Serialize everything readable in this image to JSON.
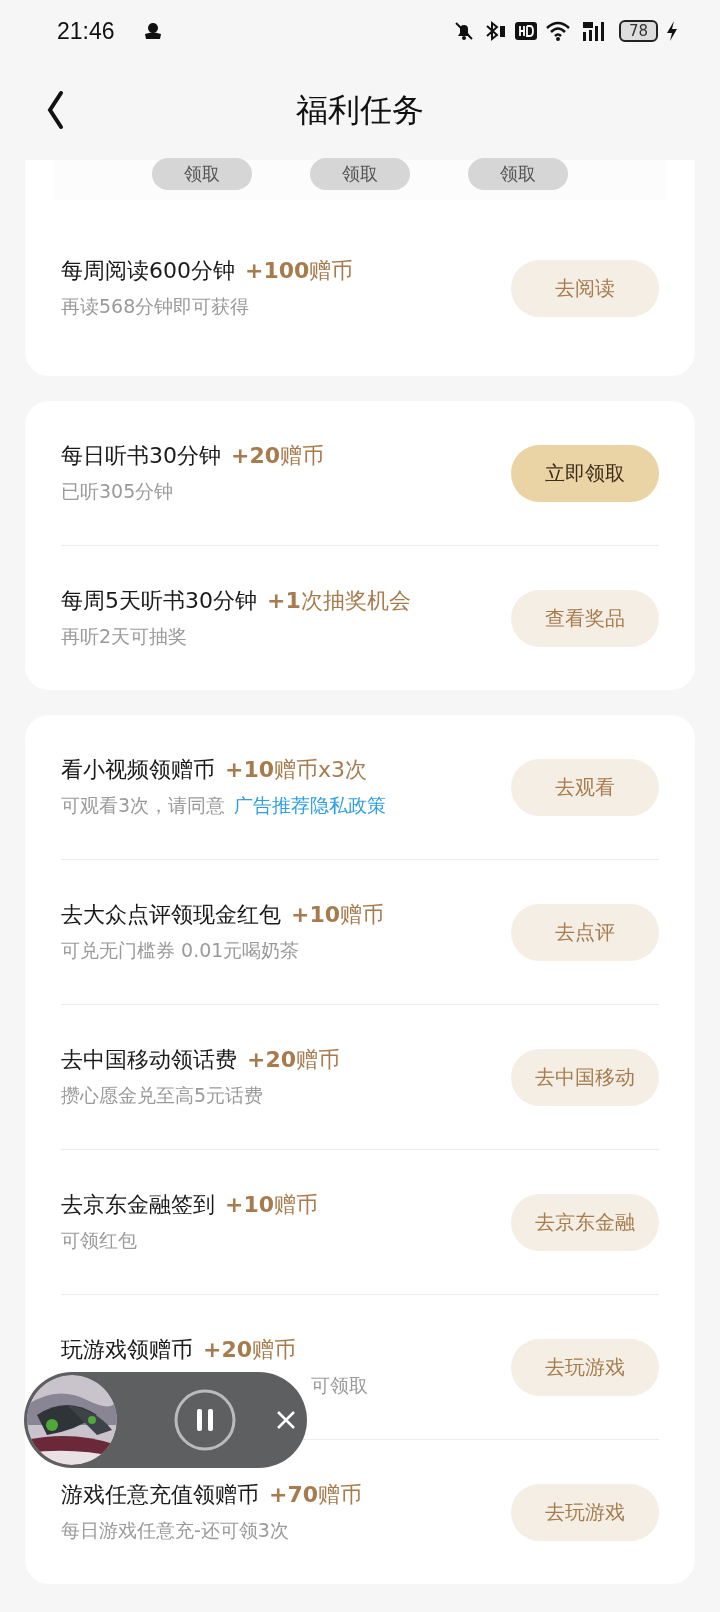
{
  "status_bar": {
    "time": "21:46",
    "battery": "78"
  },
  "header": {
    "title": "福利任务"
  },
  "claim_strip": [
    {
      "label": "领取",
      "disabled": true
    },
    {
      "label": "领取",
      "disabled": true
    },
    {
      "label": "领取",
      "disabled": true
    }
  ],
  "cards": [
    {
      "tasks": [
        {
          "title": "每周阅读600分钟",
          "reward": "**+100**赠币",
          "subtitle": "再读568分钟即可获得",
          "covered": false,
          "button": {
            "label": "去阅读",
            "kind": "normal"
          }
        }
      ]
    },
    {
      "tasks": [
        {
          "title": "每日听书30分钟",
          "reward": "**+20**赠币",
          "subtitle": "已听305分钟",
          "covered": false,
          "button": {
            "label": "立即领取",
            "kind": "primary"
          }
        },
        {
          "title": "每周5天听书30分钟",
          "reward": "**+1**次抽奖机会",
          "subtitle": "再听2天可抽奖",
          "covered": false,
          "button": {
            "label": "查看奖品",
            "kind": "normal"
          }
        }
      ]
    },
    {
      "tasks": [
        {
          "title": "看小视频领赠币",
          "reward": "**+10**赠币x3次",
          "subtitle": "可观看3次，请同意",
          "link": "广告推荐隐私政策",
          "covered": false,
          "button": {
            "label": "去观看",
            "kind": "normal"
          }
        },
        {
          "title": "去大众点评领现金红包",
          "reward": "**+10**赠币",
          "subtitle": "可兑无门槛券 0.01元喝奶茶",
          "covered": false,
          "button": {
            "label": "去点评",
            "kind": "normal"
          }
        },
        {
          "title": "去中国移动领话费",
          "reward": "**+20**赠币",
          "subtitle": "攒心愿金兑至高5元话费",
          "covered": false,
          "button": {
            "label": "去中国移动",
            "kind": "normal"
          }
        },
        {
          "title": "去京东金融签到",
          "reward": "**+10**赠币",
          "subtitle": "可领红包",
          "covered": false,
          "button": {
            "label": "去京东金融",
            "kind": "normal"
          }
        },
        {
          "title": "玩游戏领赠币",
          "reward": "**+20**赠币",
          "subtitle": "可领取",
          "covered": true,
          "button": {
            "label": "去玩游戏",
            "kind": "normal"
          }
        },
        {
          "title": "游戏任意充值领赠币",
          "reward": "**+70**赠币",
          "subtitle": "每日游戏任意充-还可领3次",
          "covered": false,
          "button": {
            "label": "去玩游戏",
            "kind": "normal"
          }
        }
      ]
    }
  ]
}
